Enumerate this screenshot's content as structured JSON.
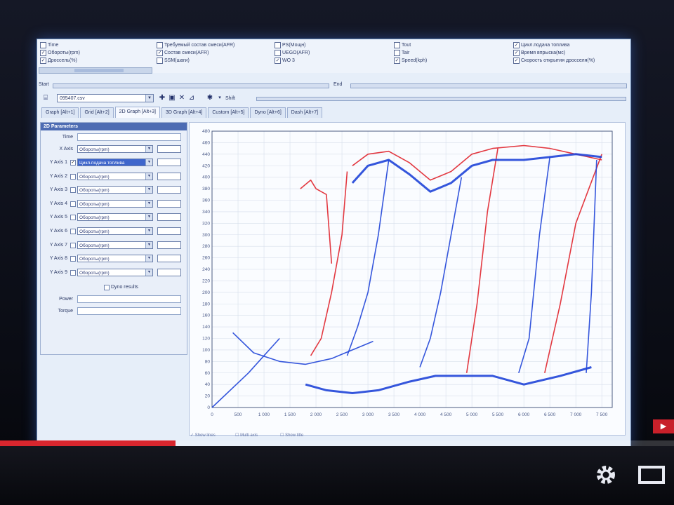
{
  "app": {
    "top_checkboxes": [
      {
        "label": "Time",
        "checked": false
      },
      {
        "label": "Обороты(rpm)",
        "checked": true
      },
      {
        "label": "Дроссель(%)",
        "checked": true
      },
      {
        "label": "Требуемый состав смеси(AFR)",
        "checked": false
      },
      {
        "label": "Состав смеси(AFR)",
        "checked": true
      },
      {
        "label": "SSM(шаги)",
        "checked": false
      },
      {
        "label": "PS(Мощн)",
        "checked": false
      },
      {
        "label": "UEGO(AFR)",
        "checked": false
      },
      {
        "label": "WO 3",
        "checked": true
      },
      {
        "label": "Tout",
        "checked": false
      },
      {
        "label": "Tair",
        "checked": false
      },
      {
        "label": "Speed(kph)",
        "checked": true
      },
      {
        "label": "Цикл.подача топлива",
        "checked": true
      },
      {
        "label": "Время впрыска(мс)",
        "checked": true
      },
      {
        "label": "Скорость открытия дросселя(%)",
        "checked": true
      }
    ],
    "start_label": "Start",
    "end_label": "End",
    "file_name": "095407.csv",
    "shift_label": "Shift",
    "tabs": [
      {
        "label": "Graph [Alt+1]",
        "active": false
      },
      {
        "label": "Grid [Alt+2]",
        "active": false
      },
      {
        "label": "2D Graph [Alt+3]",
        "active": true
      },
      {
        "label": "3D Graph [Alt+4]",
        "active": false
      },
      {
        "label": "Custom [Alt+5]",
        "active": false
      },
      {
        "label": "Dyno [Alt+6]",
        "active": false
      },
      {
        "label": "Dash [Alt+7]",
        "active": false
      }
    ],
    "params": {
      "title": "2D Parameters",
      "time_label": "Time",
      "x_axis": {
        "label": "X Axis",
        "value": "Обороты(rpm)"
      },
      "y_axes": [
        {
          "label": "Y Axis 1",
          "checked": true,
          "value": "Цикл.подача топлива",
          "selected": true
        },
        {
          "label": "Y Axis 2",
          "checked": false,
          "value": "Обороты(rpm)",
          "selected": false
        },
        {
          "label": "Y Axis 3",
          "checked": false,
          "value": "Обороты(rpm)",
          "selected": false
        },
        {
          "label": "Y Axis 4",
          "checked": false,
          "value": "Обороты(rpm)",
          "selected": false
        },
        {
          "label": "Y Axis 5",
          "checked": false,
          "value": "Обороты(rpm)",
          "selected": false
        },
        {
          "label": "Y Axis 6",
          "checked": false,
          "value": "Обороты(rpm)",
          "selected": false
        },
        {
          "label": "Y Axis 7",
          "checked": false,
          "value": "Обороты(rpm)",
          "selected": false
        },
        {
          "label": "Y Axis 8",
          "checked": false,
          "value": "Обороты(rpm)",
          "selected": false
        },
        {
          "label": "Y Axis 9",
          "checked": false,
          "value": "Обороты(rpm)",
          "selected": false
        }
      ],
      "dyno_label": "Dyno results",
      "power_label": "Power",
      "torque_label": "Torque"
    },
    "graph_options": [
      "Show lines",
      "Multi axis",
      "Show title"
    ]
  },
  "chart_data": {
    "type": "line",
    "title": "",
    "xlabel": "",
    "ylabel": "",
    "xlim": [
      0,
      7700
    ],
    "ylim": [
      0,
      480
    ],
    "x_ticks": [
      "0",
      "500",
      "1 000",
      "1 500",
      "2 000",
      "2 500",
      "3 000",
      "3 500",
      "4 000",
      "4 500",
      "5 000",
      "5 500",
      "6 000",
      "6 500",
      "7 000",
      "7 500"
    ],
    "y_ticks": [
      "0",
      "20",
      "40",
      "60",
      "80",
      "100",
      "120",
      "140",
      "160",
      "180",
      "200",
      "220",
      "240",
      "260",
      "280",
      "300",
      "320",
      "340",
      "360",
      "380",
      "400",
      "420",
      "440",
      "460",
      "480"
    ],
    "grid": true,
    "colors": {
      "red": "#e0242c",
      "blue": "#1f44d8"
    },
    "series": [
      {
        "color": "red",
        "points": [
          [
            2700,
            420
          ],
          [
            3000,
            440
          ],
          [
            3400,
            445
          ],
          [
            3800,
            425
          ],
          [
            4200,
            395
          ],
          [
            4600,
            410
          ],
          [
            5000,
            440
          ],
          [
            5400,
            450
          ],
          [
            6000,
            455
          ],
          [
            6500,
            450
          ],
          [
            7000,
            440
          ],
          [
            7500,
            430
          ]
        ]
      },
      {
        "color": "red",
        "points": [
          [
            1700,
            380
          ],
          [
            1900,
            395
          ],
          [
            2000,
            380
          ],
          [
            2200,
            370
          ],
          [
            2300,
            250
          ]
        ]
      },
      {
        "color": "red",
        "points": [
          [
            7500,
            440
          ],
          [
            7000,
            320
          ],
          [
            6700,
            180
          ],
          [
            6400,
            60
          ]
        ]
      },
      {
        "color": "red",
        "points": [
          [
            5500,
            450
          ],
          [
            5300,
            340
          ],
          [
            5100,
            180
          ],
          [
            4900,
            60
          ]
        ]
      },
      {
        "color": "red",
        "points": [
          [
            2600,
            410
          ],
          [
            2500,
            300
          ],
          [
            2300,
            200
          ],
          [
            2100,
            120
          ],
          [
            1900,
            90
          ]
        ]
      },
      {
        "color": "blue",
        "points": [
          [
            2700,
            390
          ],
          [
            3000,
            420
          ],
          [
            3400,
            430
          ],
          [
            3800,
            405
          ],
          [
            4200,
            375
          ],
          [
            4600,
            390
          ],
          [
            5000,
            420
          ],
          [
            5400,
            430
          ],
          [
            6000,
            430
          ],
          [
            6500,
            435
          ],
          [
            7000,
            440
          ],
          [
            7500,
            435
          ]
        ]
      },
      {
        "color": "blue",
        "points": [
          [
            1800,
            40
          ],
          [
            2200,
            30
          ],
          [
            2700,
            25
          ],
          [
            3200,
            30
          ],
          [
            3800,
            45
          ],
          [
            4300,
            55
          ],
          [
            4800,
            55
          ],
          [
            5400,
            55
          ],
          [
            6000,
            40
          ],
          [
            6700,
            55
          ],
          [
            7300,
            70
          ]
        ]
      },
      {
        "color": "blue",
        "points": [
          [
            7400,
            430
          ],
          [
            7300,
            200
          ],
          [
            7200,
            60
          ]
        ]
      },
      {
        "color": "blue",
        "points": [
          [
            6500,
            435
          ],
          [
            6300,
            300
          ],
          [
            6100,
            120
          ],
          [
            5900,
            60
          ]
        ]
      },
      {
        "color": "blue",
        "points": [
          [
            4800,
            400
          ],
          [
            4600,
            300
          ],
          [
            4400,
            200
          ],
          [
            4200,
            120
          ],
          [
            4000,
            70
          ]
        ]
      },
      {
        "color": "blue",
        "points": [
          [
            3400,
            430
          ],
          [
            3200,
            300
          ],
          [
            3000,
            200
          ],
          [
            2800,
            140
          ],
          [
            2600,
            90
          ]
        ]
      },
      {
        "color": "blue",
        "points": [
          [
            0,
            0
          ],
          [
            700,
            60
          ],
          [
            1300,
            120
          ]
        ]
      },
      {
        "color": "blue",
        "points": [
          [
            400,
            130
          ],
          [
            800,
            95
          ],
          [
            1300,
            80
          ],
          [
            1800,
            75
          ],
          [
            2300,
            85
          ],
          [
            2700,
            100
          ],
          [
            3100,
            115
          ]
        ]
      }
    ]
  }
}
